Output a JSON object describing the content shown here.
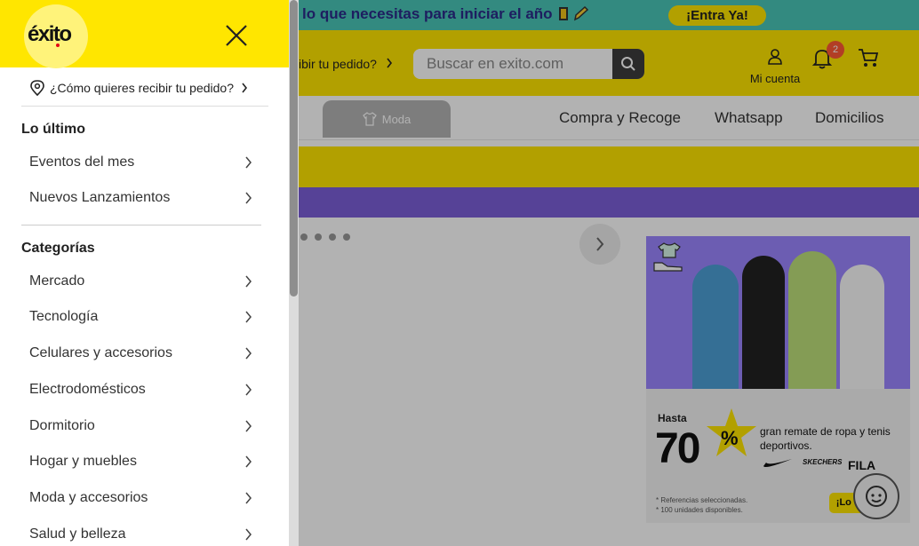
{
  "promo_bar": {
    "text": "lo que necesitas para iniciar el año",
    "cta": "¡Entra Ya!"
  },
  "header": {
    "delivery_link": "ibir tu pedido?",
    "search_placeholder": "Buscar en exito.com",
    "account_label": "Mi cuenta",
    "notifications_count": "2"
  },
  "nav": {
    "moda_tab": "Moda",
    "links": [
      "Compra y Recoge",
      "Whatsapp",
      "Domicilios"
    ]
  },
  "promo_card": {
    "hasta": "Hasta",
    "percent": "70",
    "percent_sign": "%",
    "description": "gran remate de ropa y tenis deportivos.",
    "brands": [
      "SKECHERS",
      "FILA"
    ],
    "note_1": "* Referencias seleccionadas.",
    "note_2": "* 100 unidades disponibles.",
    "button": "¡Lo quiero!"
  },
  "drawer": {
    "logo": "éxito",
    "delivery_question": "¿Cómo quieres recibir tu pedido?",
    "sections": {
      "latest_title": "Lo último",
      "latest_items": [
        "Eventos del mes",
        "Nuevos Lanzamientos"
      ],
      "categories_title": "Categorías",
      "category_items": [
        "Mercado",
        "Tecnología",
        "Celulares y accesorios",
        "Electrodomésticos",
        "Dormitorio",
        "Hogar y muebles",
        "Moda y accesorios",
        "Salud y belleza"
      ]
    }
  },
  "colors": {
    "brand_yellow": "#ffe600",
    "promo_teal": "#49c6b8",
    "promo_purple": "#7b5fd9"
  },
  "icons": [
    "location-pin-icon",
    "chevron-right-icon",
    "close-icon",
    "search-icon",
    "user-icon",
    "bell-icon",
    "cart-icon",
    "shirt-icon",
    "chat-icon"
  ]
}
